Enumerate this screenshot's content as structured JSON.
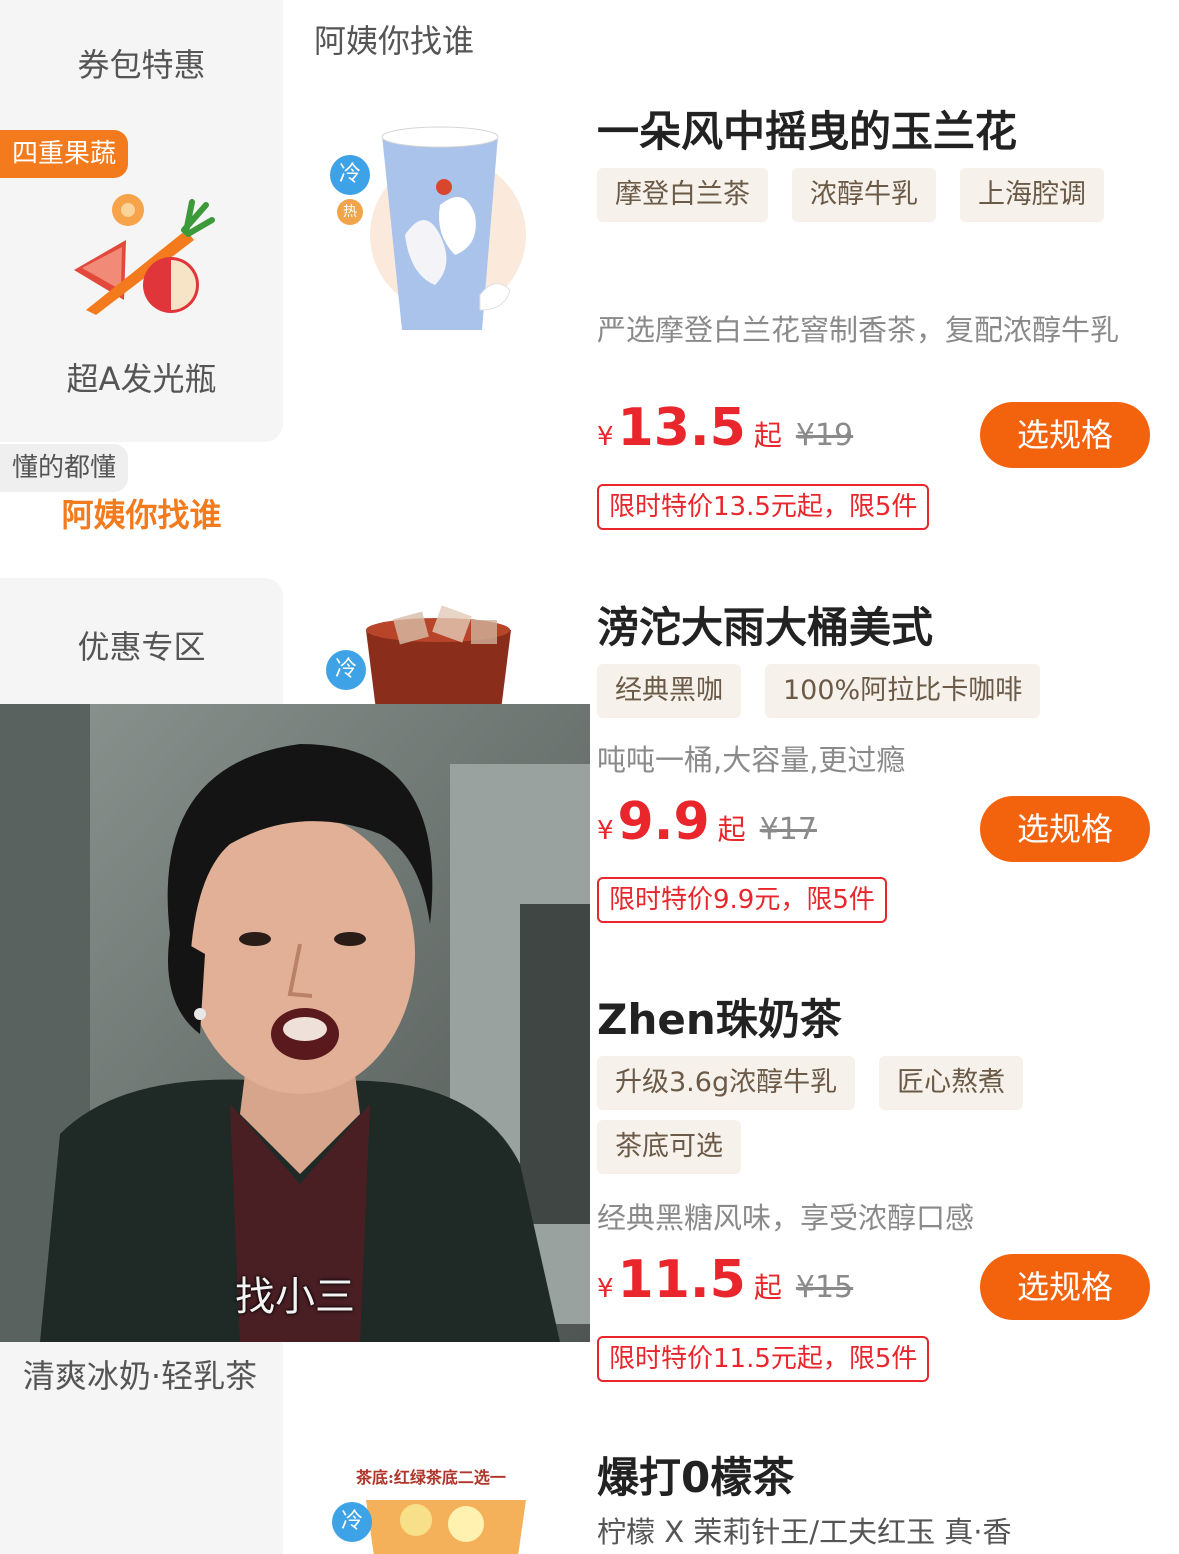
{
  "sidebar": {
    "items": [
      {
        "label": "券包特惠"
      },
      {
        "label": "超A发光瓶",
        "badge": "四重果蔬"
      },
      {
        "label": "阿姨你找谁",
        "badge": "懂的都懂",
        "active": true
      },
      {
        "label": "优惠专区"
      },
      {
        "label": "清爽冰奶·轻乳茶"
      }
    ]
  },
  "section": {
    "title": "阿姨你找谁"
  },
  "products": [
    {
      "name": "一朵风中摇曳的玉兰花",
      "tags": [
        "摩登白兰茶",
        "浓醇牛乳",
        "上海腔调"
      ],
      "desc": "严选摩登白兰花窨制香茶，复配浓醇牛乳",
      "currency": "¥",
      "price": "13.5",
      "qi": "起",
      "orig": "¥19",
      "button": "选规格",
      "promo": "限时特价13.5元起，限5件",
      "cold": "冷",
      "hot": "热"
    },
    {
      "name": "滂沱大雨大桶美式",
      "tags": [
        "经典黑咖",
        "100%阿拉比卡咖啡"
      ],
      "desc": "吨吨一桶,大容量,更过瘾",
      "currency": "¥",
      "price": "9.9",
      "qi": "起",
      "orig": "¥17",
      "button": "选规格",
      "promo": "限时特价9.9元，限5件",
      "cold": "冷"
    },
    {
      "name": "Zhen珠奶茶",
      "tags": [
        "升级3.6g浓醇牛乳",
        "匠心熬煮",
        "茶底可选"
      ],
      "desc": "经典黑糖风味，享受浓醇口感",
      "currency": "¥",
      "price": "11.5",
      "qi": "起",
      "orig": "¥15",
      "button": "选规格",
      "promo": "限时特价11.5元起，限5件"
    },
    {
      "name": "爆打0檬茶",
      "desc": "柠檬 X 茉莉针王/工夫红玉 真·香",
      "thumb_caption": "茶底:红绿茶底二选一",
      "cold": "冷"
    }
  ],
  "meme": {
    "caption": "找小三"
  },
  "colors": {
    "accent": "#f37b1d",
    "button": "#f3630d",
    "price": "#e8262b",
    "cold": "#3ea2e6"
  }
}
